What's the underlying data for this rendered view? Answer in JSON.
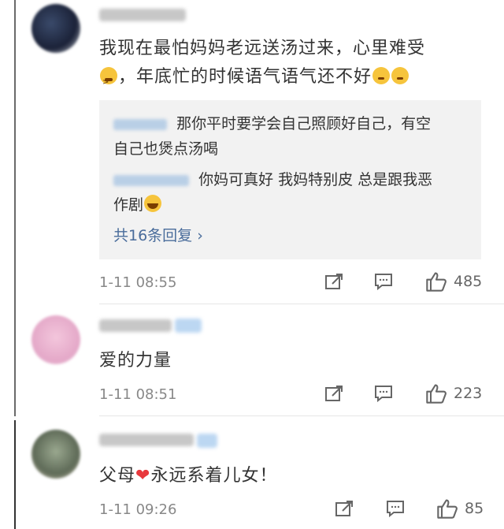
{
  "comments": [
    {
      "text_line1": "我现在最怕妈妈老远送汤过来，心里难受",
      "text_line2": "，年底忙的时候语气语气还不好",
      "emoji_before": "tired-face-emoji",
      "emoji_after": "pensive-face-emoji",
      "replies": [
        {
          "text_a": "那你平时要学会自己照顾好自己，有空",
          "text_b": "自己也煲点汤喝"
        },
        {
          "text_a": "你妈可真好 我妈特别皮 总是跟我恶",
          "text_b": "作剧"
        }
      ],
      "more_replies": "共16条回复 ›",
      "time": "1-11 08:55",
      "likes": "485"
    },
    {
      "text": "爱的力量",
      "time": "1-11 08:51",
      "likes": "223"
    },
    {
      "text_before": "父母",
      "text_after": "永远系着儿女！",
      "time": "1-11 09:26",
      "likes": "85"
    }
  ],
  "icons": {
    "share": "share-icon",
    "comment": "comment-icon",
    "like": "thumbs-up-icon",
    "heart": "heart-emoji"
  },
  "colors": {
    "link": "#496c9b",
    "meta": "#888888",
    "reply_bg": "#f2f2f2",
    "badge": "#bcd7f2"
  }
}
